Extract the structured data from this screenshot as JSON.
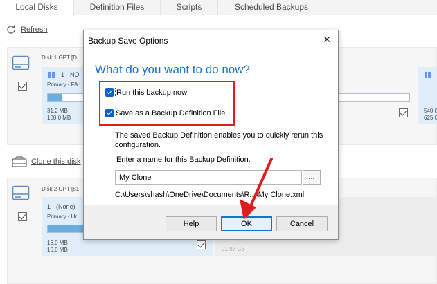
{
  "tabs": [
    {
      "label": "Local Disks",
      "active": true
    },
    {
      "label": "Definition Files",
      "active": false
    },
    {
      "label": "Scripts",
      "active": false
    },
    {
      "label": "Scheduled Backups",
      "active": false
    }
  ],
  "toolbar": {
    "refresh_label": "Refresh",
    "refresh_icon": "refresh-icon",
    "clone_label": "Clone this disk",
    "clone_icon": "clone-disk-icon"
  },
  "disk1": {
    "title": "Disk 1 GPT [D",
    "partition1": {
      "name": "1 - NO",
      "type": "Primary - FA",
      "used": "31.2 MB",
      "total": "100.0 MB",
      "fill": 0.31
    },
    "partition_right": {
      "used": "540.0",
      "total": "625.0"
    }
  },
  "disk2": {
    "title": "Disk 2 GPT [81",
    "partition1": {
      "name": "1 -  (None)",
      "type": "Primary - Ur",
      "used": "16.0 MB",
      "total": "16.0 MB",
      "fill": 1.0
    },
    "free_space": "91.97 GB"
  },
  "dialog": {
    "title": "Backup Save Options",
    "close_glyph": "✕",
    "heading": "What do you want to do now?",
    "option_run": {
      "label": "Run this backup now",
      "checked": true
    },
    "option_save": {
      "label": "Save as a Backup Definition File",
      "checked": true
    },
    "info_text": "The saved Backup Definition enables you to quickly rerun this configuration.",
    "name_label": "Enter a name for this Backup Definition.",
    "name_value": "My Clone",
    "browse_label": "...",
    "path_text": "C:\\Users\\shash\\OneDrive\\Documents\\R...\\My Clone.xml",
    "buttons": {
      "help": "Help",
      "ok": "OK",
      "cancel": "Cancel"
    }
  },
  "colors": {
    "accent": "#1c72c9",
    "highlight_box": "#e11c1c",
    "annotation_arrow": "#e11c1c"
  }
}
